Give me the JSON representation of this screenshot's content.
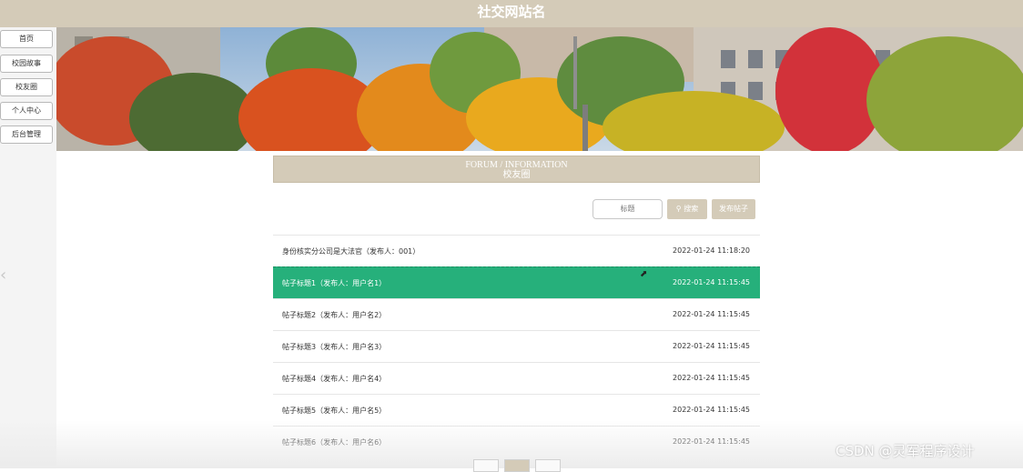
{
  "header": {
    "site_title": "社交网站名"
  },
  "sidebar": {
    "items": [
      {
        "label": "首页"
      },
      {
        "label": "校园故事"
      },
      {
        "label": "校友圈"
      },
      {
        "label": "个人中心"
      },
      {
        "label": "后台管理"
      }
    ]
  },
  "section": {
    "title_en": "FORUM / INFORMATION",
    "title_cn": "校友圈"
  },
  "search": {
    "placeholder": "标题",
    "search_label": "搜索",
    "post_label": "发布帖子"
  },
  "posts": [
    {
      "title": "身份核实分公司是大法官（发布人：001）",
      "date": "2022-01-24 11:18:20"
    },
    {
      "title": "帖子标题1（发布人：用户名1）",
      "date": "2022-01-24 11:15:45"
    },
    {
      "title": "帖子标题2（发布人：用户名2）",
      "date": "2022-01-24 11:15:45"
    },
    {
      "title": "帖子标题3（发布人：用户名3）",
      "date": "2022-01-24 11:15:45"
    },
    {
      "title": "帖子标题4（发布人：用户名4）",
      "date": "2022-01-24 11:15:45"
    },
    {
      "title": "帖子标题5（发布人：用户名5）",
      "date": "2022-01-24 11:15:45"
    },
    {
      "title": "帖子标题6（发布人：用户名6）",
      "date": "2022-01-24 11:15:45"
    }
  ],
  "watermark": "CSDN @灵军程序设计",
  "colors": {
    "accent": "#d4cbb8",
    "active_row": "#26b07b"
  }
}
